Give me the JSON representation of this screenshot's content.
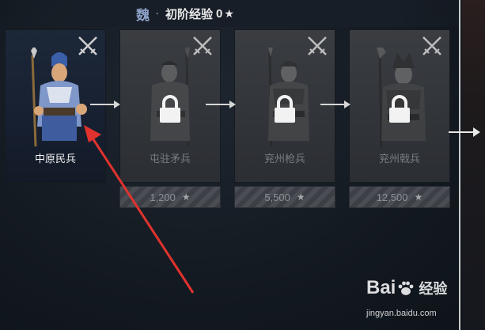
{
  "header": {
    "faction": "魏",
    "separator": "·",
    "tier_label": "初阶经验",
    "exp_value": "0",
    "star": "★"
  },
  "units": [
    {
      "name": "中原民兵",
      "state": "unlocked",
      "cost": null
    },
    {
      "name": "屯驻矛兵",
      "state": "locked",
      "cost": "1,200"
    },
    {
      "name": "兖州枪兵",
      "state": "locked",
      "cost": "5,500"
    },
    {
      "name": "兖州戟兵",
      "state": "locked",
      "cost": "12,500"
    }
  ],
  "cost_star": "★",
  "icons": {
    "swords": "crossed-swords-icon",
    "lock": "padlock-icon"
  },
  "colors": {
    "annotation_arrow": "#e0332e",
    "faction": "#8ea2c8"
  },
  "watermark": {
    "brand_left": "Bai",
    "brand_right": "经验",
    "url": "jingyan.baidu.com"
  }
}
